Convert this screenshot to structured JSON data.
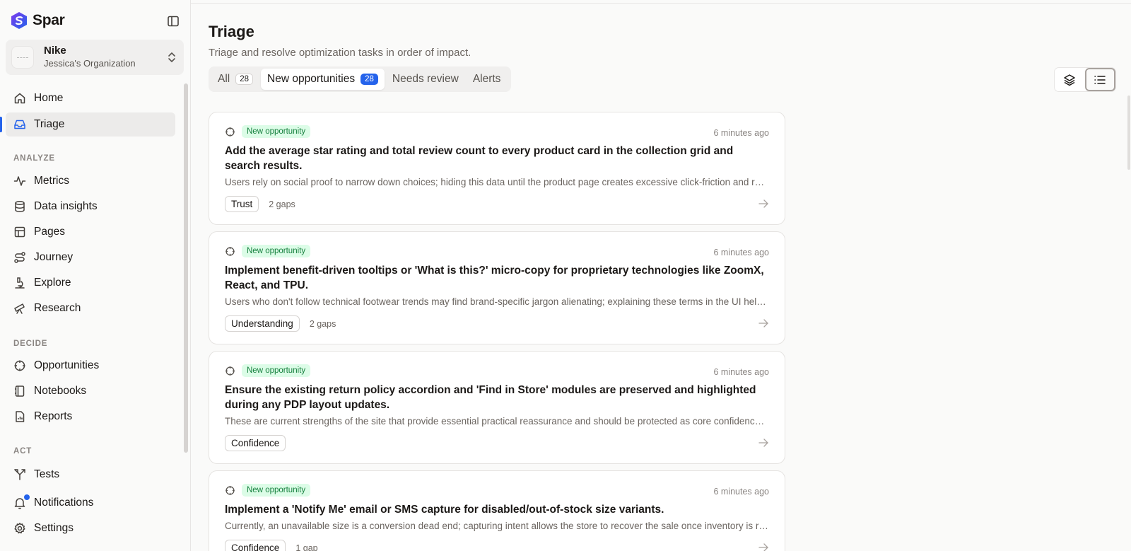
{
  "brand": {
    "name": "Spar"
  },
  "org": {
    "name": "Nike",
    "subtitle": "Jessica's Organization"
  },
  "nav": {
    "main": [
      {
        "label": "Home",
        "icon": "home-icon"
      },
      {
        "label": "Triage",
        "icon": "inbox-icon",
        "active": true
      }
    ],
    "analyze_label": "ANALYZE",
    "analyze": [
      {
        "label": "Metrics",
        "icon": "activity-icon"
      },
      {
        "label": "Data insights",
        "icon": "database-icon"
      },
      {
        "label": "Pages",
        "icon": "layout-icon"
      },
      {
        "label": "Journey",
        "icon": "route-icon"
      },
      {
        "label": "Explore",
        "icon": "microscope-icon"
      },
      {
        "label": "Research",
        "icon": "telescope-icon"
      }
    ],
    "decide_label": "DECIDE",
    "decide": [
      {
        "label": "Opportunities",
        "icon": "crosshair-icon"
      },
      {
        "label": "Notebooks",
        "icon": "notebook-icon"
      },
      {
        "label": "Reports",
        "icon": "report-icon"
      }
    ],
    "act_label": "ACT",
    "act": [
      {
        "label": "Tests",
        "icon": "split-icon"
      },
      {
        "label": "Notifications",
        "icon": "bell-icon"
      },
      {
        "label": "Settings",
        "icon": "gear-icon"
      }
    ]
  },
  "page": {
    "title": "Triage",
    "subtitle": "Triage and resolve optimization tasks in order of impact."
  },
  "tabs": [
    {
      "label": "All",
      "count": "28"
    },
    {
      "label": "New opportunities",
      "count": "28",
      "active": true
    },
    {
      "label": "Needs review"
    },
    {
      "label": "Alerts"
    }
  ],
  "cards": [
    {
      "badge": "New opportunity",
      "time": "6 minutes ago",
      "title": "Add the average star rating and total review count to every product card in the collection grid and search results.",
      "description": "Users rely on social proof to narrow down choices; hiding this data until the product page creates excessive click-friction and reduces confidence in the selection process.",
      "tag": "Trust",
      "gaps": "2 gaps"
    },
    {
      "badge": "New opportunity",
      "time": "6 minutes ago",
      "title": "Implement benefit-driven tooltips or 'What is this?' micro-copy for proprietary technologies like ZoomX, React, and TPU.",
      "description": "Users who don't follow technical footwear trends may find brand-specific jargon alienating; explaining these terms in the UI helps connect features to benefits.",
      "tag": "Understanding",
      "gaps": "2 gaps"
    },
    {
      "badge": "New opportunity",
      "time": "6 minutes ago",
      "title": "Ensure the existing return policy accordion and 'Find in Store' modules are preserved and highlighted during any PDP layout updates.",
      "description": "These are current strengths of the site that provide essential practical reassurance and should be protected as core confidence builders.",
      "tag": "Confidence",
      "gaps": ""
    },
    {
      "badge": "New opportunity",
      "time": "6 minutes ago",
      "title": "Implement a 'Notify Me' email or SMS capture for disabled/out-of-stock size variants.",
      "description": "Currently, an unavailable size is a conversion dead end; capturing intent allows the store to recover the sale once inventory is replenished.",
      "tag": "Confidence",
      "gaps": "1 gap"
    }
  ],
  "colors": {
    "accent": "#2563eb",
    "badge_bg": "#dcfce7",
    "badge_text": "#15803d"
  }
}
